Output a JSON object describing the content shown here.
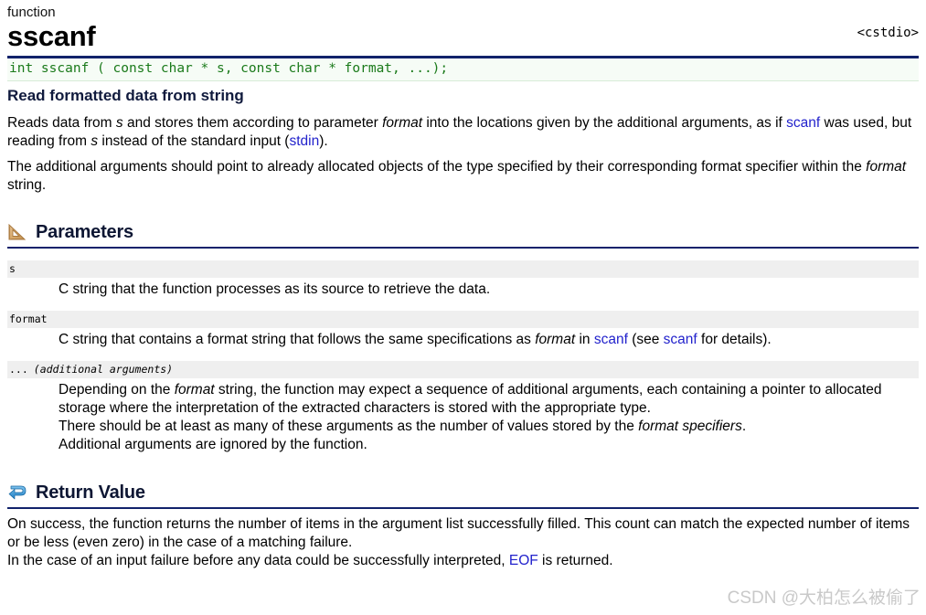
{
  "header": {
    "kind": "function",
    "title": "sscanf",
    "include": "<cstdio>"
  },
  "prototype": {
    "text": "int sscanf ( const char * s, const char * format, ...);"
  },
  "subtitle": "Read formatted data from string",
  "description": {
    "p1": {
      "t1": "Reads data from ",
      "i1": "s",
      "t2": " and stores them according to parameter ",
      "i2": "format",
      "t3": " into the locations given by the additional arguments, as if ",
      "link1": "scanf",
      "t4": " was used, but reading from ",
      "i3": "s",
      "t5": " instead of the standard input (",
      "link2": "stdin",
      "t6": ")."
    },
    "p2": {
      "t1": "The additional arguments should point to already allocated objects of the type specified by their corresponding format specifier within the ",
      "i1": "format",
      "t2": " string."
    }
  },
  "sections": {
    "parameters": {
      "heading": "Parameters",
      "icon": "set-square-ruler-icon",
      "items": [
        {
          "name": "s",
          "extra": "",
          "desc": {
            "t1": "C string that the function processes as its source to retrieve the data."
          }
        },
        {
          "name": "format",
          "extra": "",
          "desc": {
            "t1": "C string that contains a format string that follows the same specifications as ",
            "i1": "format",
            "t2": " in ",
            "link1": "scanf",
            "t3": " (see ",
            "link2": "scanf",
            "t4": " for details)."
          }
        },
        {
          "name": "...",
          "extra": "(additional arguments)",
          "desc": {
            "t1": "Depending on the ",
            "i1": "format",
            "t2": " string, the function may expect a sequence of additional arguments, each containing a pointer to allocated storage where the interpretation of the extracted characters is stored with the appropriate type.",
            "t3": "There should be at least as many of these arguments as the number of values stored by the ",
            "i2": "format specifiers",
            "t4": ".",
            "t5": "Additional arguments are ignored by the function."
          }
        }
      ]
    },
    "return_value": {
      "heading": "Return Value",
      "icon": "return-arrow-icon",
      "line1": "On success, the function returns the number of items in the argument list successfully filled. This count can match the expected number of items or be less (even zero) in the case of a matching failure.",
      "line2_t1": "In the case of an input failure before any data could be successfully interpreted, ",
      "line2_link": "EOF",
      "line2_t2": " is returned."
    }
  },
  "watermark": "CSDN @大柏怎么被偷了",
  "colors": {
    "rule_navy": "#11226b",
    "link_blue": "#2222cc",
    "code_green": "#1a7a1a",
    "param_bar_gray": "#efefef",
    "watermark_gray": "#c9c9c9"
  }
}
